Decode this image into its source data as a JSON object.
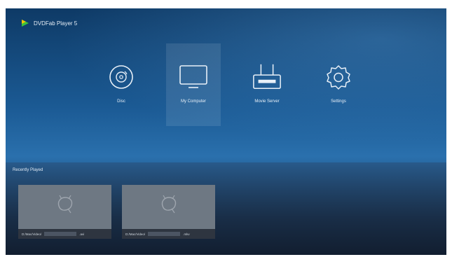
{
  "app": {
    "title": "DVDFab Player 5"
  },
  "nav": {
    "items": [
      {
        "label": "Disc",
        "icon": "disc-icon"
      },
      {
        "label": "My Computer",
        "icon": "monitor-icon",
        "active": true
      },
      {
        "label": "Movie Server",
        "icon": "router-icon"
      },
      {
        "label": "Settings",
        "icon": "gear-icon"
      }
    ]
  },
  "recent": {
    "title": "Recently Played",
    "items": [
      {
        "path": "D:/Mac/Video/",
        "ext": ".avi"
      },
      {
        "path": "D:/Mac/Video/",
        "ext": ".mkv"
      }
    ]
  },
  "colors": {
    "accent": "#f5c400",
    "logo_green": "#3cc23c",
    "background_top": "#0e3a66",
    "background_bottom": "#14273f"
  }
}
